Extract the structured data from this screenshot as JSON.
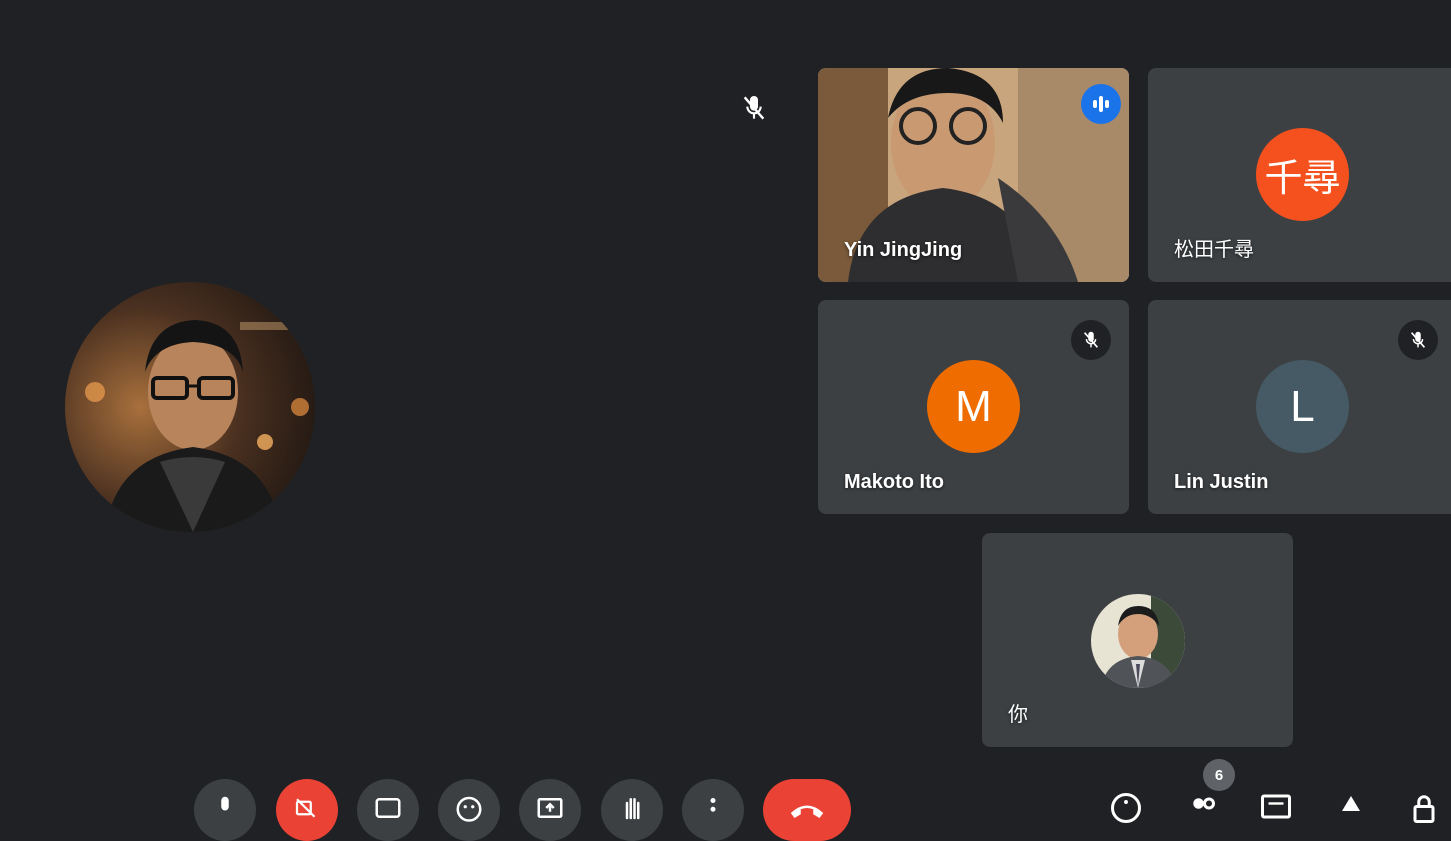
{
  "participants": [
    {
      "name": "Yin JingJing",
      "status": "speaking"
    },
    {
      "name": "松田千尋",
      "initials": "千尋",
      "avatar_color": "#f4511e"
    },
    {
      "name": "Makoto Ito",
      "initials": "M",
      "avatar_color": "#ef6c00",
      "muted": true
    },
    {
      "name": "Lin Justin",
      "initials": "L",
      "avatar_color": "#455a64",
      "muted": true
    },
    {
      "name": "你",
      "is_self": true
    }
  ],
  "presenter": {
    "muted": true
  },
  "controls": [
    "microphone-button",
    "camera-off-button",
    "captions-button",
    "reactions-button",
    "present-button",
    "raise-hand-button",
    "more-options-button",
    "leave-call-button"
  ],
  "right_controls": {
    "people_count": "6"
  },
  "colors": {
    "background": "#202124",
    "tile": "#3c4043",
    "accent": "#1a73e8",
    "danger": "#ea4335"
  }
}
